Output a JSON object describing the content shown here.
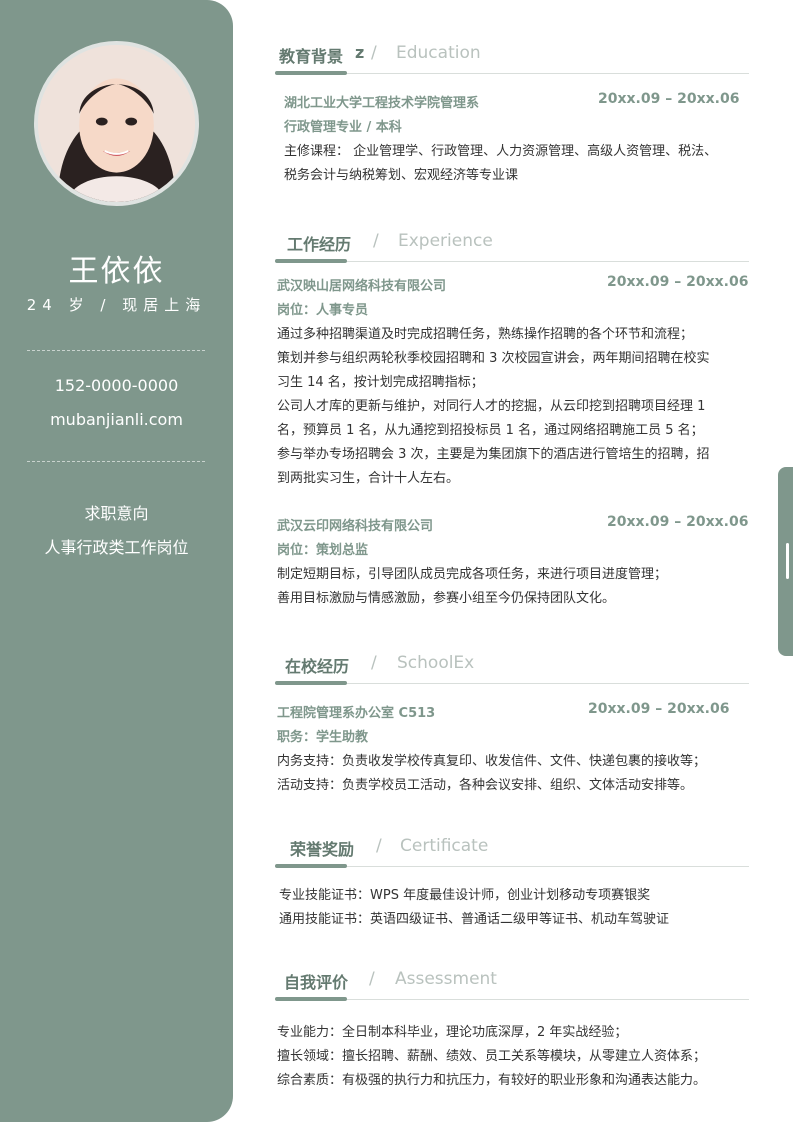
{
  "profile": {
    "name": "王依依",
    "age_location": "24 岁 / 现居上海",
    "phone": "152-0000-0000",
    "website": "mubanjianli.com",
    "intent_title": "求职意向",
    "intent_value": "人事行政类工作岗位"
  },
  "education": {
    "title_cn": "教育背景",
    "title_mark": "z",
    "slash": "/",
    "title_en": "Education",
    "school": "湖北工业大学工程技术学院管理系",
    "date": "20xx.09 – 20xx.06",
    "major": "行政管理专业 / 本科",
    "courses": [
      "主修课程： 企业管理学、行政管理、人力资源管理、高级人资管理、税法、",
      "税务会计与纳税筹划、宏观经济等专业课"
    ]
  },
  "experience": {
    "title_cn": "工作经历",
    "slash": "/",
    "title_en": "Experience",
    "jobs": [
      {
        "company": "武汉映山居网络科技有限公司",
        "date": "20xx.09 – 20xx.06",
        "position": "岗位：人事专员",
        "lines": [
          "通过多种招聘渠道及时完成招聘任务，熟练操作招聘的各个环节和流程；",
          "策划并参与组织两轮秋季校园招聘和 3 次校园宣讲会，两年期间招聘在校实",
          "习生 14 名，按计划完成招聘指标；",
          "公司人才库的更新与维护，对同行人才的挖掘，从云印挖到招聘项目经理 1",
          "名，预算员 1 名，从九通挖到招投标员 1 名，通过网络招聘施工员 5 名；",
          "参与举办专场招聘会 3 次，主要是为集团旗下的酒店进行管培生的招聘，招",
          "到两批实习生，合计十人左右。"
        ]
      },
      {
        "company": "武汉云印网络科技有限公司",
        "date": "20xx.09 – 20xx.06",
        "position": "岗位：策划总监",
        "lines": [
          "制定短期目标，引导团队成员完成各项任务，来进行项目进度管理；",
          "善用目标激励与情感激励，参赛小组至今仍保持团队文化。"
        ]
      }
    ]
  },
  "school": {
    "title_cn": "在校经历",
    "slash": "/",
    "title_en": "SchoolEx",
    "org": "工程院管理系办公室 C513",
    "date": "20xx.09 – 20xx.06",
    "position": "职务：学生助教",
    "lines": [
      "内务支持：负责收发学校传真复印、收发信件、文件、快递包裹的接收等；",
      "活动支持：负责学校员工活动，各种会议安排、组织、文体活动安排等。"
    ]
  },
  "certificate": {
    "title_cn": "荣誉奖励",
    "slash": "/",
    "title_en": "Certificate",
    "lines": [
      "专业技能证书：WPS 年度最佳设计师，创业计划移动专项赛银奖",
      "通用技能证书：英语四级证书、普通话二级甲等证书、机动车驾驶证"
    ]
  },
  "assessment": {
    "title_cn": "自我评价",
    "slash": "/",
    "title_en": "Assessment",
    "lines": [
      "专业能力：全日制本科毕业，理论功底深厚，2  年实战经验；",
      "擅长领域：擅长招聘、薪酬、绩效、员工关系等模块，从零建立人资体系；",
      "综合素质：有极强的执行力和抗压力，有较好的职业形象和沟通表达能力。"
    ]
  }
}
